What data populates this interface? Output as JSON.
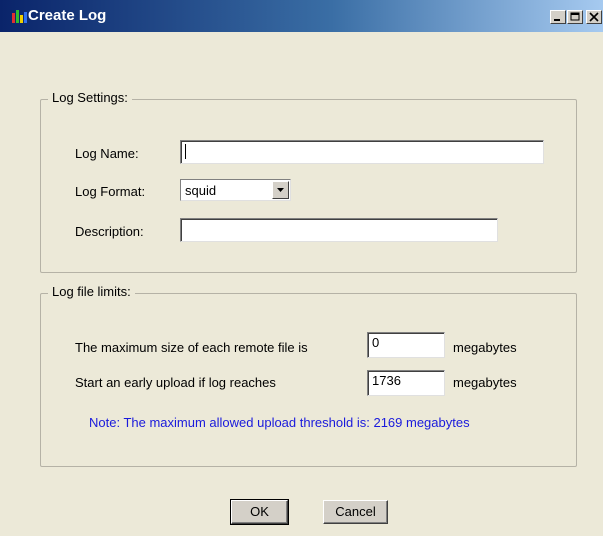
{
  "window": {
    "title": "Create Log"
  },
  "log_settings": {
    "group_title": "Log Settings:",
    "log_name_label": "Log Name:",
    "log_name_value": "",
    "log_format_label": "Log Format:",
    "log_format_selected": "squid",
    "description_label": "Description:",
    "description_value": ""
  },
  "log_file_limits": {
    "group_title": "Log file limits:",
    "max_size_label": "The maximum size of each remote file is",
    "max_size_value": "0",
    "max_size_unit": "megabytes",
    "early_upload_label": "Start an early upload if log reaches",
    "early_upload_value": "1736",
    "early_upload_unit": "megabytes",
    "note": "Note: The maximum allowed upload threshold is: 2169 megabytes"
  },
  "buttons": {
    "ok": "OK",
    "cancel": "Cancel"
  },
  "colors": {
    "title_bar_start": "#0a246a",
    "note_text": "#1a1adc",
    "dialog_bg": "#ece9d8"
  }
}
